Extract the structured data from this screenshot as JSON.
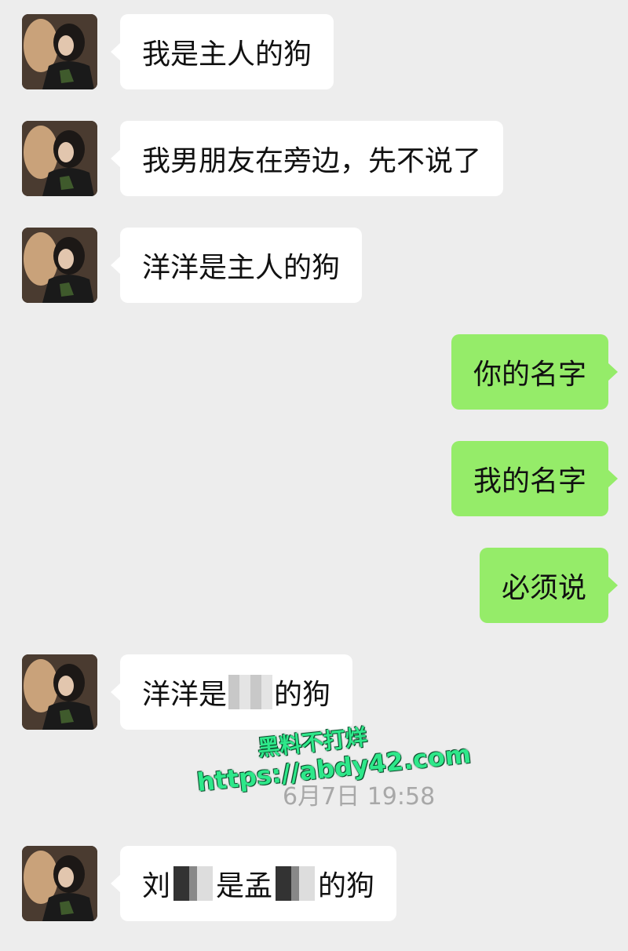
{
  "conversation": {
    "messages": [
      {
        "side": "in",
        "text": "我是主人的狗"
      },
      {
        "side": "in",
        "text": "我男朋友在旁边，先不说了"
      },
      {
        "side": "in",
        "text": "洋洋是主人的狗"
      },
      {
        "side": "out",
        "text": "你的名字"
      },
      {
        "side": "out",
        "text": "我的名字"
      },
      {
        "side": "out",
        "text": "必须说"
      },
      {
        "side": "in",
        "text_before": "洋洋是",
        "text_after": "的狗"
      },
      {
        "side": "in",
        "text_a": "刘",
        "text_b": "是孟",
        "text_c": "的狗"
      }
    ],
    "timestamp": "6月7日 19:58"
  },
  "watermark": {
    "line1": "黑料不打烊",
    "line2": "https://abdy42.com"
  },
  "colors": {
    "background": "#ededed",
    "incoming_bubble": "#ffffff",
    "outgoing_bubble": "#95ec69",
    "watermark": "#2ee88a"
  }
}
